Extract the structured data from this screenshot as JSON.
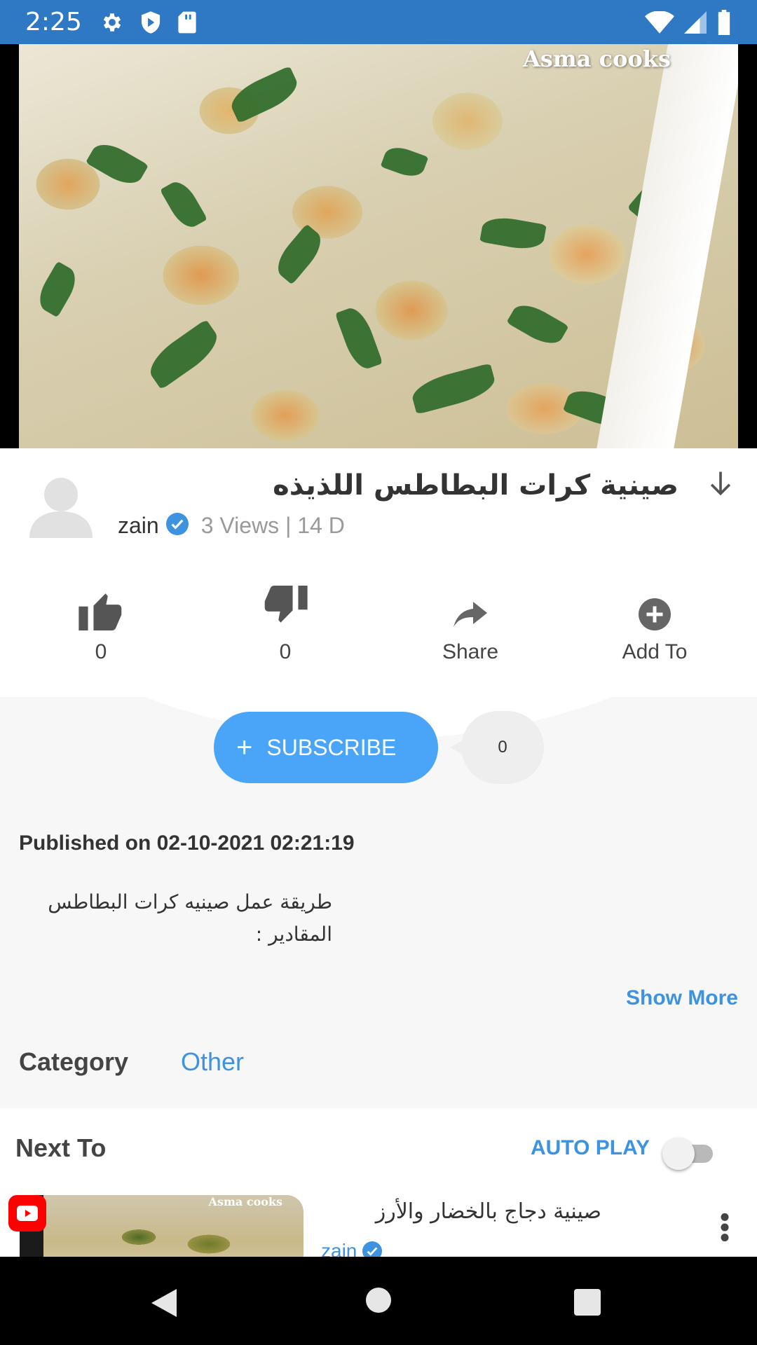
{
  "status_bar": {
    "time": "2:25",
    "icons_left": [
      "settings-icon",
      "shield-icon",
      "sd-card-icon"
    ],
    "icons_right": [
      "wifi-icon",
      "cell-signal-icon",
      "battery-icon"
    ]
  },
  "video": {
    "watermark": "Asma cooks"
  },
  "video_info": {
    "title": "صينية كرات البطاطس اللذيذه",
    "channel": "zain",
    "meta": "3 Views | 14 D"
  },
  "actions": {
    "like_count": "0",
    "dislike_count": "0",
    "share_label": "Share",
    "add_to_label": "Add To"
  },
  "subscribe": {
    "label": "SUBSCRIBE",
    "count": "0"
  },
  "description": {
    "published": "Published on 02-10-2021 02:21:19",
    "line1": "طريقة عمل صينيه كرات البطاطس",
    "line2": "المقادير :",
    "show_more": "Show More"
  },
  "category": {
    "label": "Category",
    "value": "Other"
  },
  "next": {
    "label": "Next To",
    "autoplay_label": "AUTO PLAY",
    "autoplay_on": false,
    "item": {
      "watermark": "Asma cooks",
      "title": "صينية دجاج بالخضار والأرز",
      "channel": "zain"
    }
  },
  "colors": {
    "status_bar": "#2f78c4",
    "accent": "#4aa4f7",
    "link": "#3d93e0",
    "panel": "#f7f7f7"
  }
}
